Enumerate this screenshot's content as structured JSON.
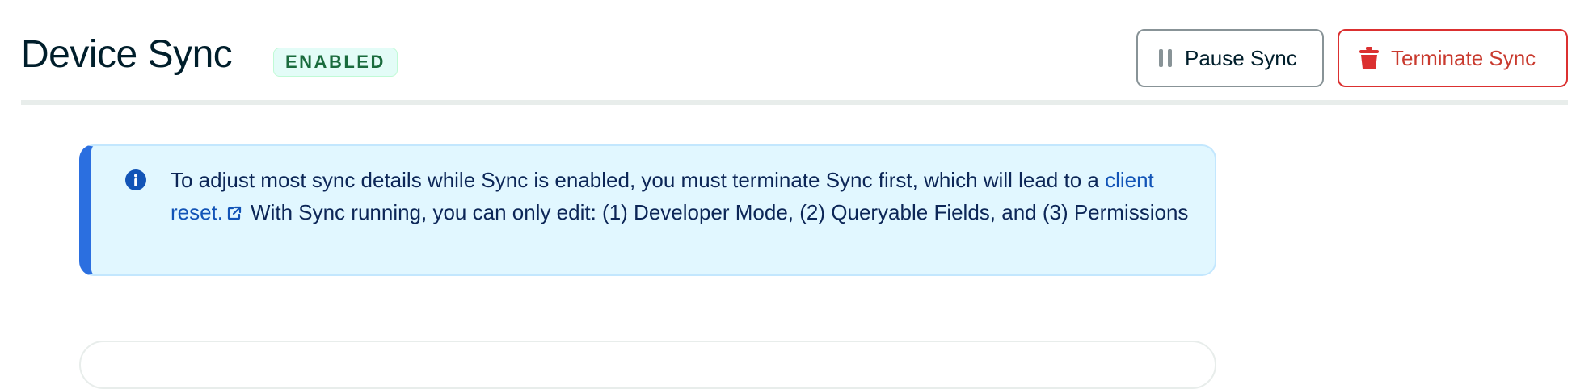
{
  "header": {
    "title": "Device Sync",
    "status_badge": "ENABLED"
  },
  "actions": {
    "pause_label": "Pause Sync",
    "terminate_label": "Terminate Sync",
    "pause_icon": "pause-icon",
    "terminate_icon": "trash-icon"
  },
  "info_banner": {
    "text_before_link": "To adjust most sync details while Sync is enabled, you must terminate Sync first, which will lead to a ",
    "link_text": "client reset.",
    "text_after_link": "With Sync running, you can only edit: (1) Developer Mode, (2) Queryable Fields, and (3) Permissions",
    "icon": "info-icon",
    "link_icon": "external-link-icon"
  },
  "colors": {
    "danger": "#db3030",
    "info_accent": "#2b6fe0",
    "info_background": "#e1f7ff",
    "success_badge_bg": "#e3fcf7",
    "success_badge_text": "#1a6b3d",
    "text_primary": "#001e2b",
    "link": "#1254b7"
  }
}
